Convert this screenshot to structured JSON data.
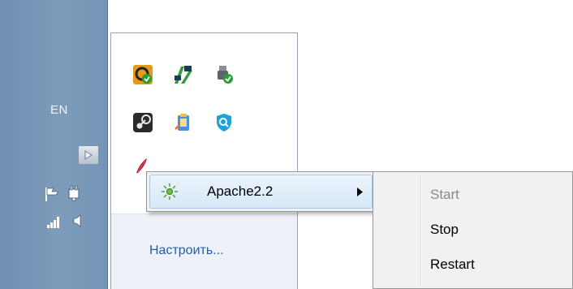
{
  "taskbar": {
    "language": "EN",
    "system_icons": [
      "show-hidden-icons-icon",
      "action-center-flag-icon",
      "power-icon",
      "network-signal-icon",
      "volume-icon"
    ]
  },
  "overflow": {
    "app_icons": [
      "screen-recorder-icon",
      "network-map-icon",
      "usb-device-icon",
      "steam-icon",
      "clipboard-app-icon",
      "shield-search-icon"
    ],
    "customize_label": "Настроить..."
  },
  "context_menu": {
    "service_label": "Apache2.2",
    "status_color": "#4caf24",
    "submenu": [
      {
        "label": "Start",
        "enabled": false
      },
      {
        "label": "Stop",
        "enabled": true
      },
      {
        "label": "Restart",
        "enabled": true
      }
    ]
  }
}
